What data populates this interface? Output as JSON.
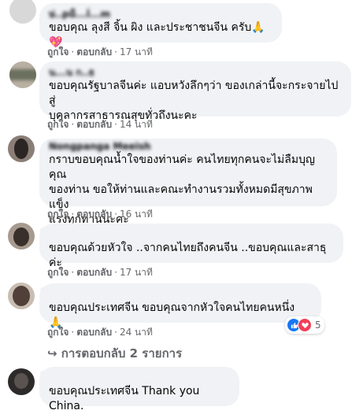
{
  "comments": [
    {
      "author": "ษ่..pu็...l่...m",
      "text": "ขอบคุณ ลุงสี จิ้น ผิง และประชาชนจีน ครับ🙏💖",
      "like": "ถูกใจ",
      "reply": "ตอบกลับ",
      "time": "17 นาที"
    },
    {
      "author": "น...น ก..ธ",
      "text_lines": [
        "ขอบคุณรัฐบาลจีนค่ะ แอบหวังลึกๆว่า ของเกล่านี้จะกระจายไปสู่",
        "บุคลากรสาธารณสุขทั่วถึงนะคะ"
      ],
      "like": "ถูกใจ",
      "reply": "ตอบกลับ",
      "time": "14 นาที"
    },
    {
      "author": "Nongpanga Meeish",
      "text_lines": [
        "กราบขอบคุณน้ำใจของท่านค่ะ คนไทยทุกคนจะไม่ลืมบุญคุณ",
        "ของท่าน ขอให้ท่านและคณะทำงานรวมทั้งหมดมีสุขภาพแข็ง",
        "แรงทุกท่านนะคะ"
      ],
      "like": "ถูกใจ",
      "reply": "ตอบกลับ",
      "time": "16 นาที"
    },
    {
      "text": "ขอบคุณด้วยหัวใจ ..จากคนไทยถึงคนจีน ..ขอบคุณและสาธุค่ะ",
      "like": "ถูกใจ",
      "reply": "ตอบกลับ",
      "time": "17 นาที"
    },
    {
      "text": "ขอบคุณประเทศจีน ขอบคุณจากหัวใจคนไทยคนหนึ่ง 🙏",
      "like": "ถูกใจ",
      "reply": "ตอบกลับ",
      "time": "24 นาที",
      "reaction_count": "5"
    },
    {
      "text": "ขอบคุณประเทศจีน Thank you China."
    }
  ],
  "replies_toggle": "↪ การตอบกลับ 2 รายการ",
  "dot": "·",
  "colors": {
    "bubble": "#f0f2f5",
    "meta": "#65676b",
    "like_blue": "#1877f2",
    "love_red": "#f33e58"
  }
}
